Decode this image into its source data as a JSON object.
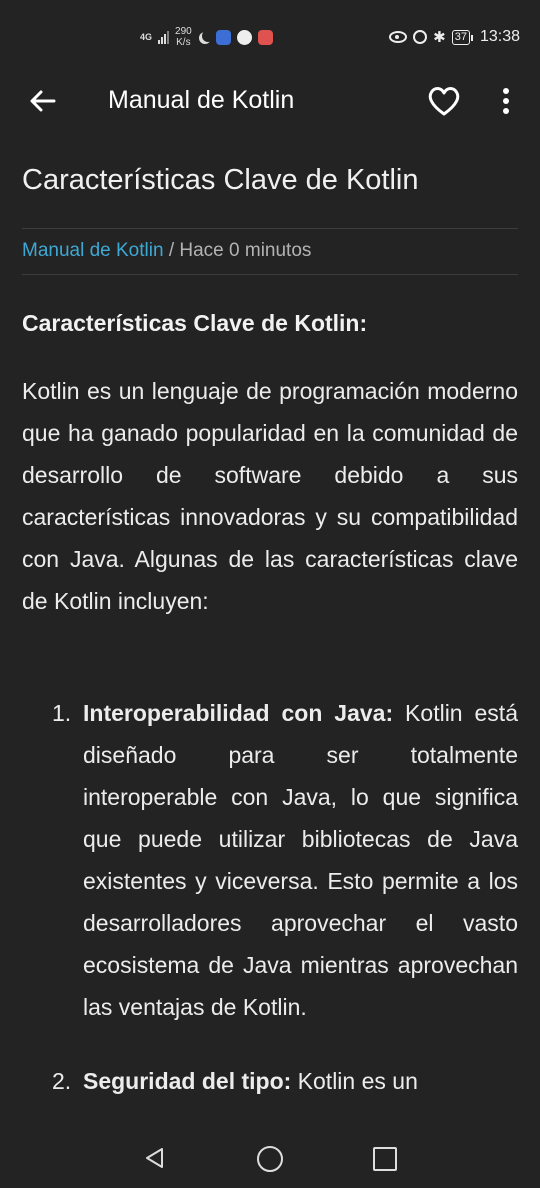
{
  "status_bar": {
    "network": "4G",
    "speed_value": "290",
    "speed_unit": "K/s",
    "battery": "37",
    "time": "13:38"
  },
  "app_bar": {
    "title": "Manual de Kotlin",
    "back_icon": "arrow-left-icon",
    "favorite_icon": "heart-outline-icon",
    "more_icon": "more-vertical-icon"
  },
  "article": {
    "title": "Características Clave de Kotlin",
    "category": "Manual de Kotlin",
    "separator": " / ",
    "time_ago": "Hace 0 minutos",
    "subheading": "Características Clave de Kotlin:",
    "intro": "Kotlin es un lenguaje de programación moderno que ha ganado popularidad en la comunidad de desarrollo de software debido a sus características innovadoras y su compatibilidad con Java. Algunas de las características clave de Kotlin incluyen:",
    "items": [
      {
        "number": "1.",
        "heading": "Interoperabilidad con Java:",
        "text": " Kotlin está diseñado para ser totalmente interoperable con Java, lo que significa que puede utilizar bibliotecas de Java existentes y viceversa. Esto permite a los desarrolladores aprovechar el vasto ecosistema de Java mientras aprovechan las ventajas de Kotlin."
      },
      {
        "number": "2.",
        "heading": "Seguridad del tipo:",
        "text": " Kotlin es un"
      }
    ]
  },
  "nav_bar": {
    "back_icon": "triangle-back-icon",
    "home_icon": "circle-home-icon",
    "recents_icon": "square-recents-icon"
  }
}
